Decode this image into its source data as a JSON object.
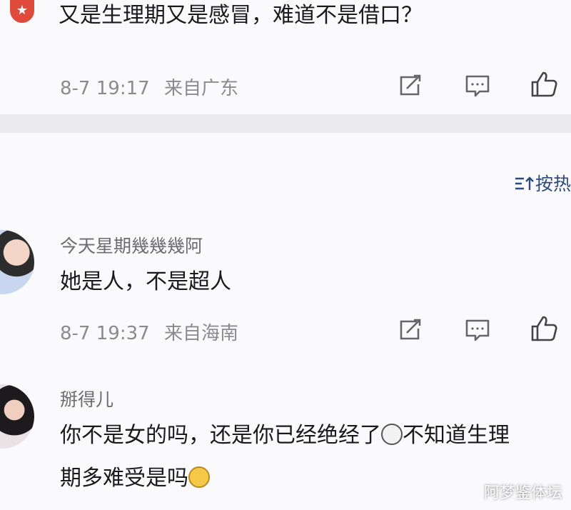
{
  "comments": [
    {
      "text": "又是生理期又是感冒，难道不是借口？",
      "time": "8-7 19:17",
      "location": "来自广东"
    },
    {
      "username": "今天星期幾幾幾阿",
      "text": "她是人，不是超人",
      "time": "8-7 19:37",
      "location": "来自海南"
    },
    {
      "username": "掰得儿",
      "text_line1": "你不是女的吗，还是你已经绝经了",
      "text_line1_tail": "不知道生理",
      "text_line2": "期多难受是吗"
    }
  ],
  "sort": {
    "icon": "sort-icon",
    "label": "按热"
  },
  "icons": [
    "share-icon",
    "comment-icon",
    "like-icon",
    "star-badge-icon",
    "shocked-emoji-icon",
    "laugh-cry-emoji-icon"
  ],
  "colors": {
    "badge": "#e04a3a",
    "sort_label": "#2b4b7c",
    "meta": "#8a8a8f"
  },
  "watermark": "阿梦鉴体坛"
}
